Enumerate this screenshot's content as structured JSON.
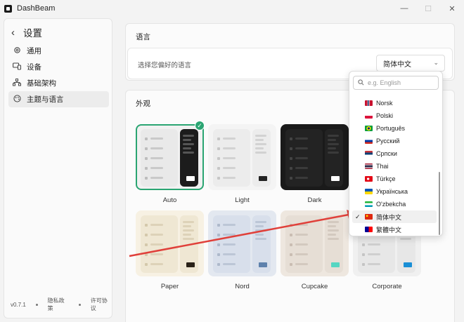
{
  "window": {
    "title": "DashBeam",
    "minimize": "—",
    "maximize": "☐",
    "close": "✕"
  },
  "sidebar": {
    "title": "设置",
    "items": [
      {
        "label": "通用",
        "icon": "gear-icon"
      },
      {
        "label": "设备",
        "icon": "devices-icon"
      },
      {
        "label": "基础架构",
        "icon": "infrastructure-icon"
      },
      {
        "label": "主题与语言",
        "icon": "palette-icon"
      }
    ],
    "footer": {
      "version": "v0.7.1",
      "privacy": "隐私政策",
      "license": "许可协议"
    }
  },
  "language_section": {
    "title": "语言",
    "prompt": "选择您偏好的语言",
    "selected": "简体中文"
  },
  "appearance_section": {
    "title": "外观",
    "themes": [
      {
        "name": "Auto",
        "selected": true
      },
      {
        "name": "Light"
      },
      {
        "name": "Dark"
      },
      {
        "name": "Paper"
      },
      {
        "name": "Nord"
      },
      {
        "name": "Cupcake"
      },
      {
        "name": "Corporate"
      }
    ]
  },
  "dropdown": {
    "search_placeholder": "e.g. English",
    "options": [
      {
        "label": "Norsk",
        "flag": "norway"
      },
      {
        "label": "Polski",
        "flag": "poland"
      },
      {
        "label": "Português",
        "flag": "brazil"
      },
      {
        "label": "Русский",
        "flag": "russia"
      },
      {
        "label": "Српски",
        "flag": "serbia"
      },
      {
        "label": "Thai",
        "flag": "thailand"
      },
      {
        "label": "Türkçe",
        "flag": "turkey"
      },
      {
        "label": "Українська",
        "flag": "ukraine"
      },
      {
        "label": "O'zbekcha",
        "flag": "uzbekistan"
      },
      {
        "label": "简体中文",
        "flag": "china",
        "selected": true
      },
      {
        "label": "繁體中文",
        "flag": "taiwan"
      }
    ]
  },
  "colors": {
    "accent": "#2aa572",
    "annotation": "#e0403a"
  }
}
